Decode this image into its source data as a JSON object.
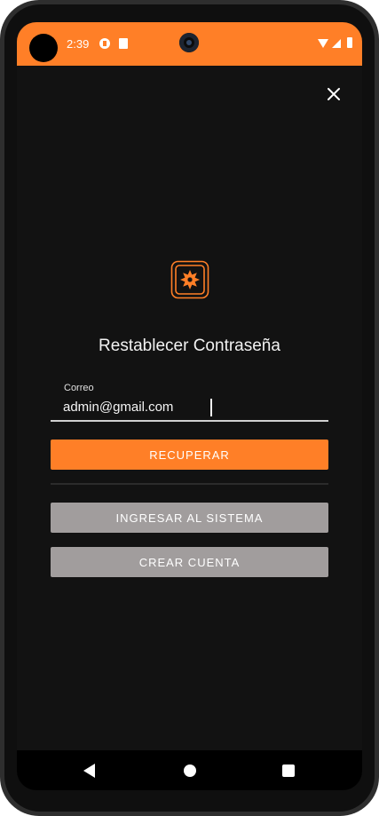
{
  "status_bar": {
    "time": "2:39"
  },
  "icons": {
    "close": "close-icon",
    "logo": "app-logo-icon"
  },
  "colors": {
    "accent": "#ff7f27",
    "background": "#121212",
    "secondary_button": "#a19d9d"
  },
  "screen": {
    "title": "Restablecer Contraseña",
    "email_field": {
      "label": "Correo",
      "value": "admin@gmail.com"
    },
    "buttons": {
      "recover": "RECUPERAR",
      "login": "INGRESAR AL SISTEMA",
      "create_account": "CREAR CUENTA"
    }
  }
}
